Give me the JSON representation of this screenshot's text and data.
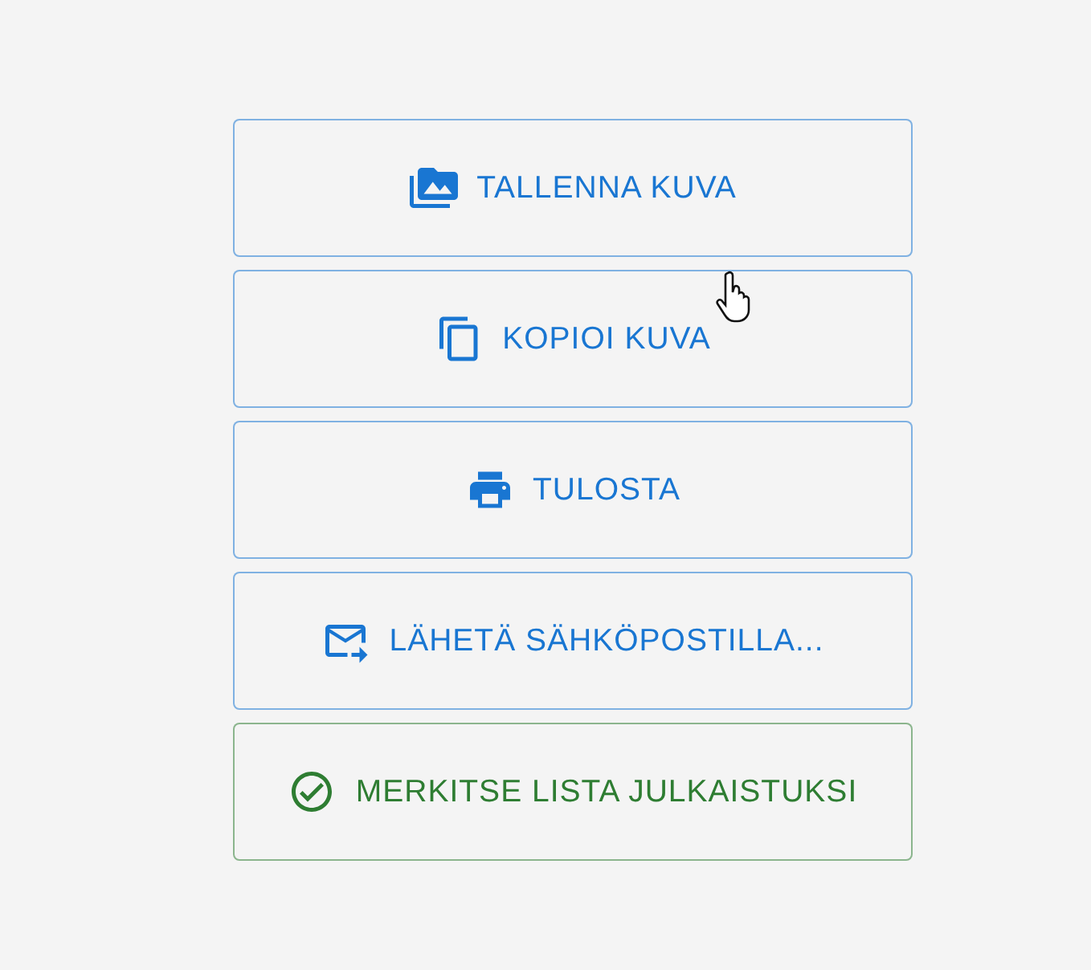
{
  "actions": [
    {
      "label": "TALLENNA KUVA",
      "kind": "save-image",
      "color": "#1976d2"
    },
    {
      "label": "KOPIOI KUVA",
      "kind": "copy",
      "color": "#1976d2"
    },
    {
      "label": "TULOSTA",
      "kind": "print",
      "color": "#1976d2"
    },
    {
      "label": "LÄHETÄ SÄHKÖPOSTILLA...",
      "kind": "email",
      "color": "#1976d2"
    },
    {
      "label": "MERKITSE LISTA JULKAISTUKSI",
      "kind": "publish",
      "color": "#2e7d32"
    }
  ]
}
